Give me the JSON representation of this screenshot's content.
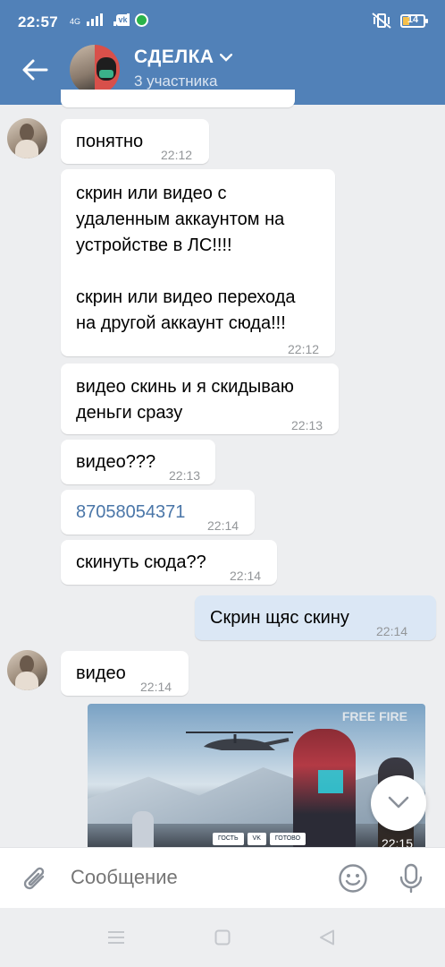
{
  "status_bar": {
    "time": "22:57",
    "network": "4G",
    "battery_level": "14"
  },
  "header": {
    "title": "СДЕЛКА",
    "subtitle": "3 участника"
  },
  "messages": [
    {
      "text": "понятно",
      "time": "22:12"
    },
    {
      "text": "скрин или видео с\nудаленным аккаунтом на\nустройстве в ЛС!!!!\n\nскрин или видео перехода\nна другой аккаунт сюда!!!",
      "time": "22:12"
    },
    {
      "text": "видео скинь и я скидываю\nденьги сразу",
      "time": "22:13"
    },
    {
      "text": "видео???",
      "time": "22:13"
    },
    {
      "text": "87058054371",
      "time": "22:14"
    },
    {
      "text": "скинуть сюда??",
      "time": "22:14"
    },
    {
      "text": "Скрин щяс скину",
      "time": "22:14",
      "outgoing": true
    },
    {
      "text": "видео",
      "time": "22:14"
    }
  ],
  "video": {
    "duration": "22:15",
    "watermark": "FREE FIRE",
    "buttons": [
      "ГОСТЬ",
      "VK",
      "ГОТОВО"
    ]
  },
  "composer": {
    "placeholder": "Сообщение"
  },
  "colors": {
    "header": "#5181b8",
    "outgoing_bubble": "#dbe7f5",
    "link": "#4a76a8"
  }
}
